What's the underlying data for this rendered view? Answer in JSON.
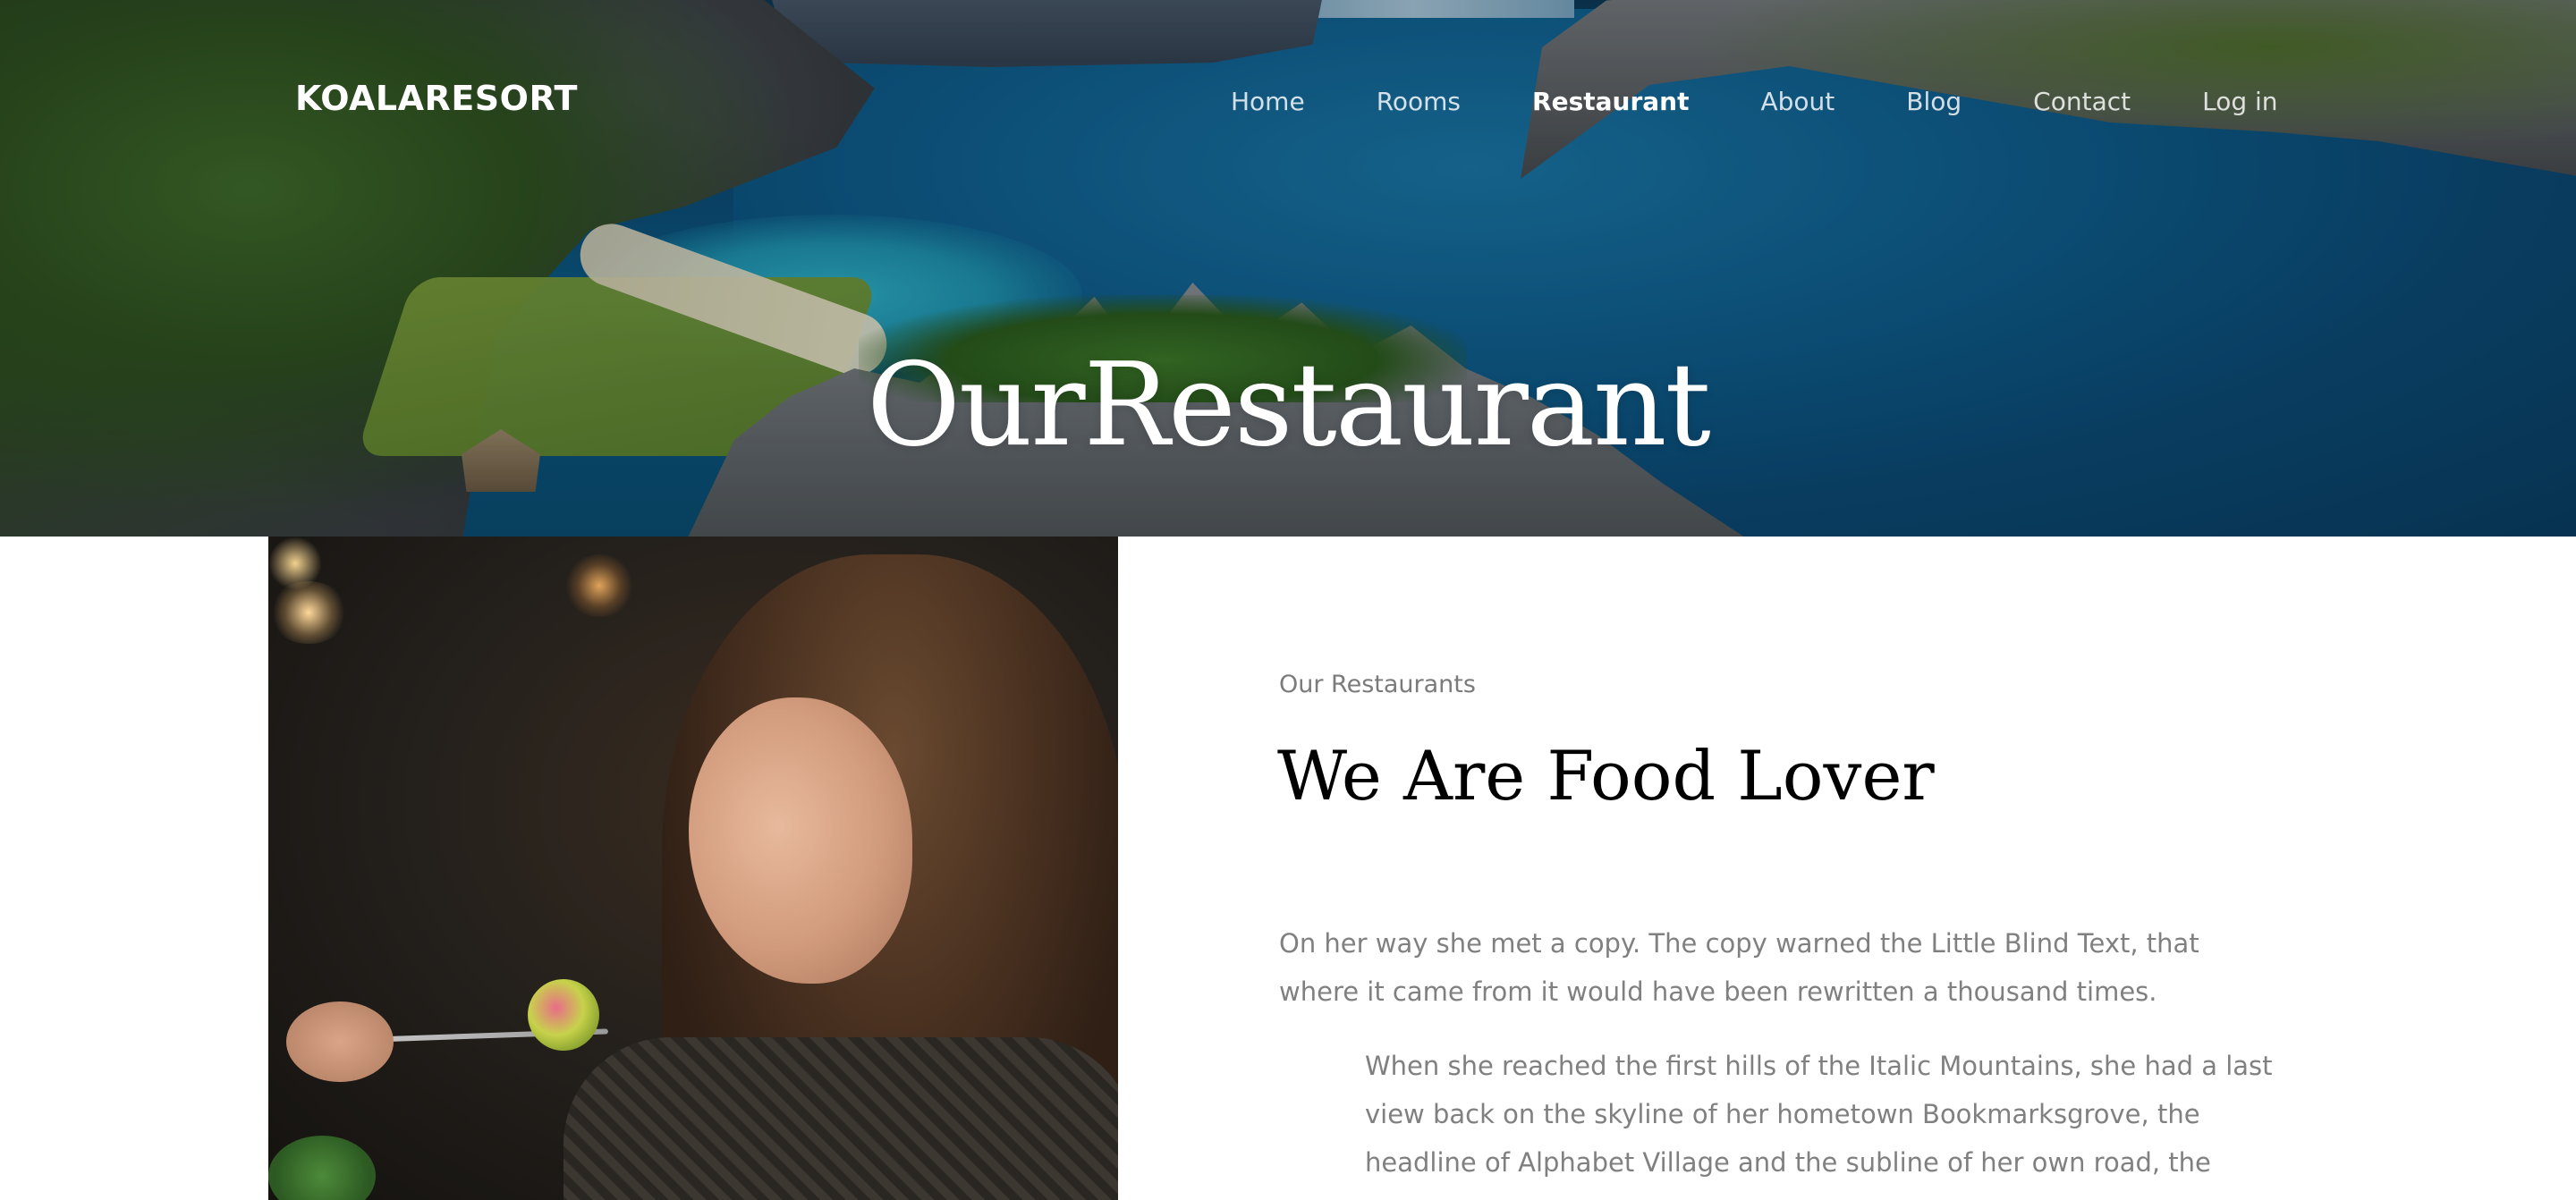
{
  "header": {
    "brand": "KOALARESORT",
    "nav": [
      {
        "label": "Home",
        "active": false
      },
      {
        "label": "Rooms",
        "active": false
      },
      {
        "label": "Restaurant",
        "active": true
      },
      {
        "label": "About",
        "active": false
      },
      {
        "label": "Blog",
        "active": false
      },
      {
        "label": "Contact",
        "active": false
      },
      {
        "label": "Log in",
        "active": false
      }
    ]
  },
  "hero": {
    "title": "OurRestaurant"
  },
  "section": {
    "eyebrow": "Our Restaurants",
    "heading": "We Are Food Lover",
    "paragraph_1": "On her way she met a copy. The copy warned the Little Blind Text, that where it came from it would have been rewritten a thousand times.",
    "paragraph_2": "When she reached the first hills of the Italic Mountains, she had a last view back on the skyline of her hometown Bookmarksgrove, the headline of Alphabet Village and the subline of her own road, the"
  },
  "colors": {
    "text_muted": "#808080",
    "heading": "#000000",
    "nav_text": "#ffffff"
  }
}
